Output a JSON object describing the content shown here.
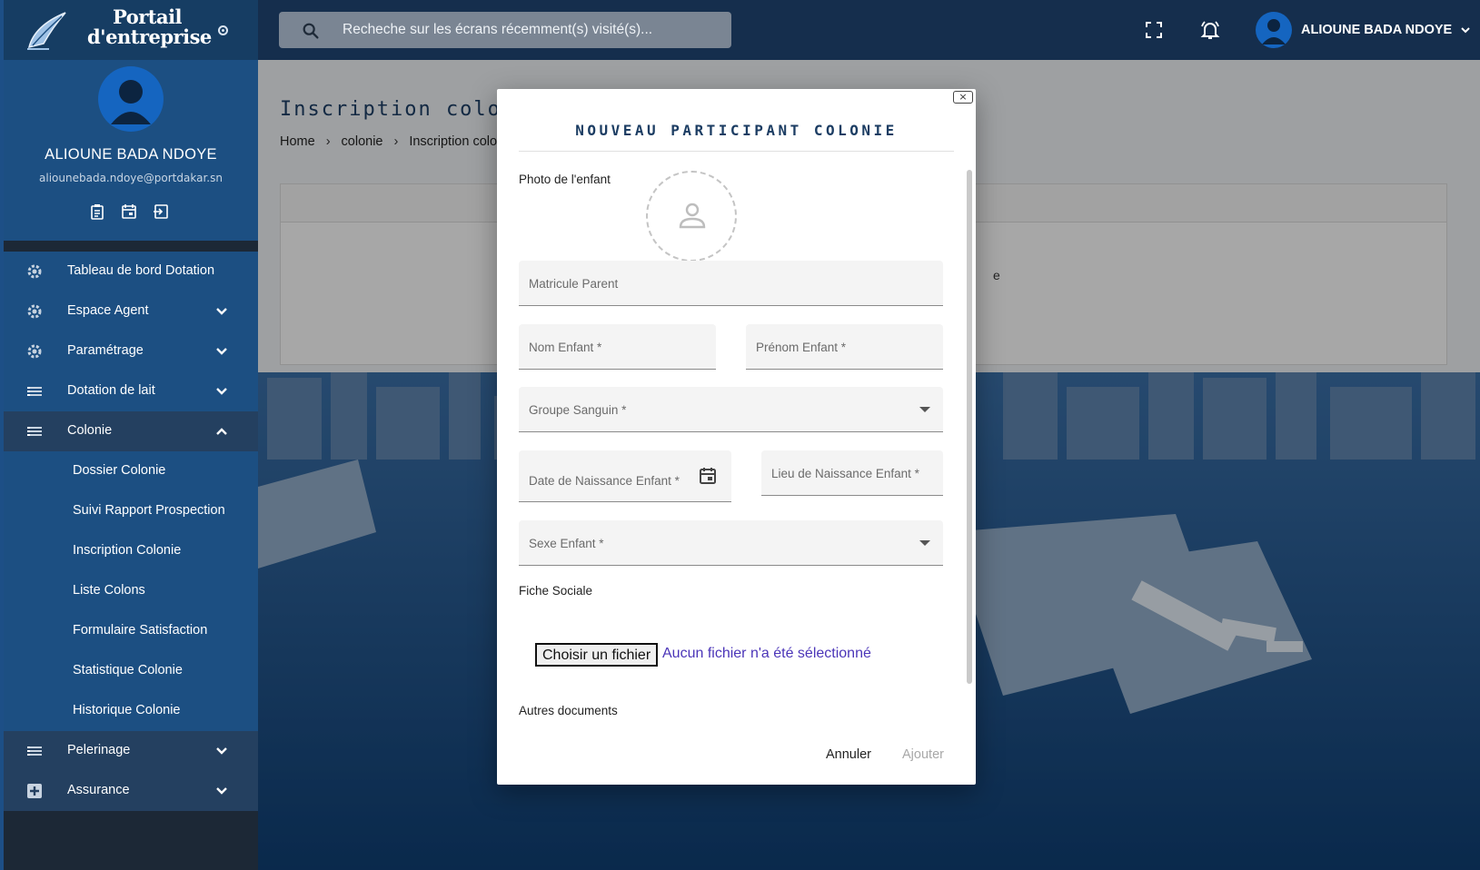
{
  "brand": {
    "line1": "Portail",
    "line2": "d'entreprise"
  },
  "profile": {
    "name": "ALIOUNE BADA NDOYE",
    "email": "aliounebada.ndoye@portdakar.sn"
  },
  "menu": [
    {
      "label": "Tableau de bord Dotation",
      "icon": "gear-icon",
      "chevron": ""
    },
    {
      "label": "Espace Agent",
      "icon": "gear-icon",
      "chevron": "down"
    },
    {
      "label": "Paramétrage",
      "icon": "gear-icon",
      "chevron": "down"
    },
    {
      "label": "Dotation de lait",
      "icon": "list-icon",
      "chevron": "down"
    },
    {
      "label": "Colonie",
      "icon": "list-icon",
      "chevron": "up"
    }
  ],
  "colonie_submenu": [
    "Dossier Colonie",
    "Suivi Rapport Prospection",
    "Inscription Colonie",
    "Liste Colons",
    "Formulaire Satisfaction",
    "Statistique Colonie",
    "Historique Colonie"
  ],
  "menu_bottom": [
    {
      "label": "Pelerinage",
      "icon": "list-icon",
      "chevron": "down"
    },
    {
      "label": "Assurance",
      "icon": "plus-box-icon",
      "chevron": "down"
    }
  ],
  "topbar": {
    "search_placeholder": "Recheche sur les écrans récemment(s) visité(s)...",
    "user_name": "ALIOUNE BADA NDOYE"
  },
  "page": {
    "title": "Inscription colonie",
    "breadcrumb": [
      "Home",
      "colonie",
      "Inscription colonie"
    ],
    "sep": "›",
    "peek_text": "e"
  },
  "modal": {
    "close": "×",
    "title": "NOUVEAU PARTICIPANT COLONIE",
    "photo_label": "Photo de l'enfant",
    "fields": {
      "matricule": "Matricule Parent",
      "nom": "Nom Enfant *",
      "prenom": "Prénom Enfant *",
      "groupe": "Groupe Sanguin *",
      "date_naissance": "Date de Naissance Enfant *",
      "lieu_naissance": "Lieu de Naissance Enfant *",
      "sexe": "Sexe Enfant *"
    },
    "fiche_label": "Fiche Sociale",
    "file_button": "Choisir un fichier",
    "file_status": "Aucun fichier n'a été sélectionné",
    "autres_label": "Autres documents",
    "cancel": "Annuler",
    "add": "Ajouter"
  },
  "colors": {
    "sidebar": "#1c4f82",
    "topbar": "#152e4d",
    "accent": "#1565c0",
    "title": "#1c3d63"
  }
}
